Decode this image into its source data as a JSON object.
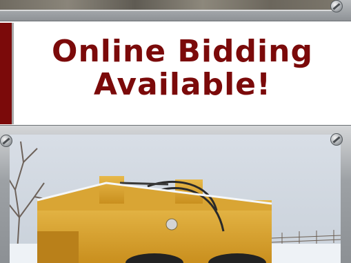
{
  "banner": {
    "line1": "Online Bidding",
    "line2": "Available!"
  },
  "photo": {
    "subject": "yellow-loader-in-snow"
  },
  "colors": {
    "banner_text": "#7b0a0a",
    "accent": "#7b0a0a",
    "frame": "#9da1a5"
  },
  "icons": [
    "screw-icon",
    "screw-icon",
    "screw-icon"
  ]
}
